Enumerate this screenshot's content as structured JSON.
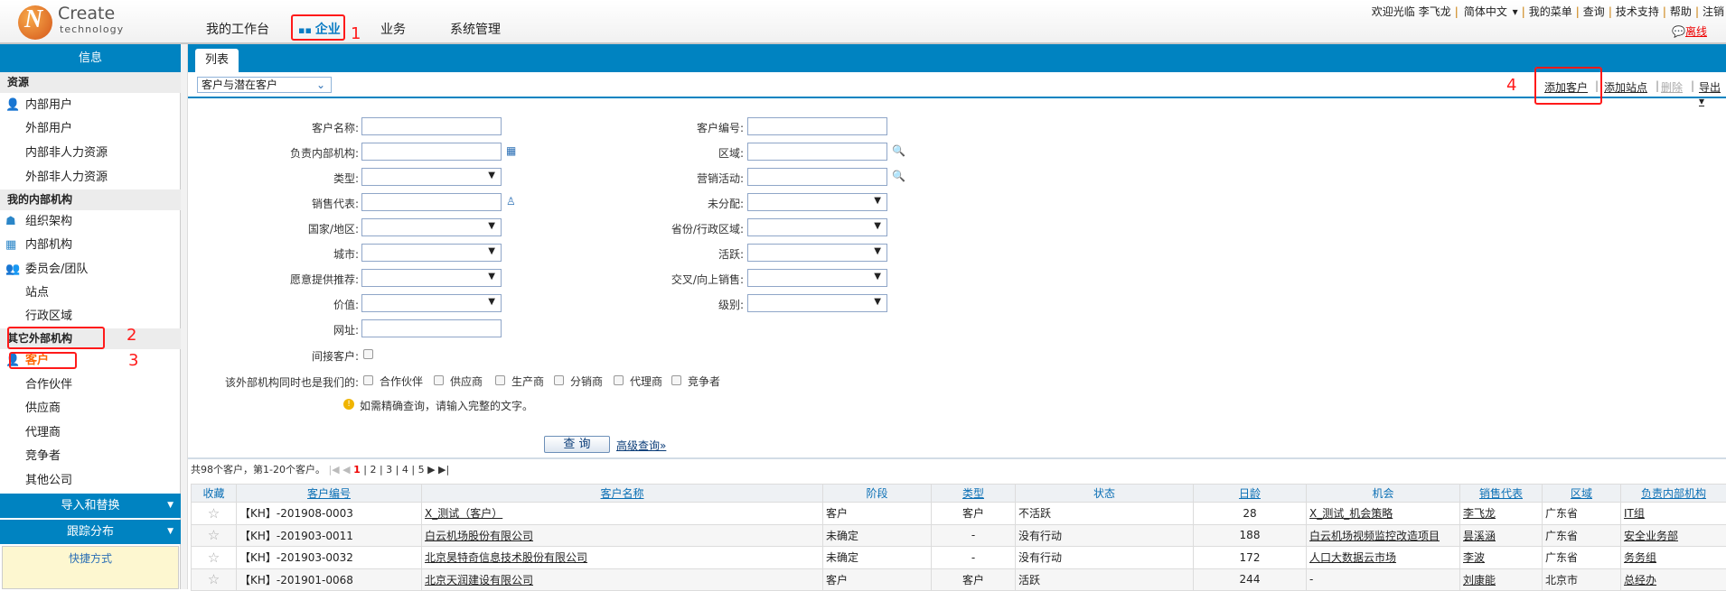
{
  "header": {
    "logo_text": "Create",
    "logo_sub": "technology",
    "nav": [
      "我的工作台",
      "企业",
      "业务",
      "系统管理"
    ],
    "active_nav": "企业",
    "top_links": [
      "欢迎光临",
      "李飞龙",
      "简体中文",
      "我的菜单",
      "查询",
      "技术支持",
      "帮助",
      "注销"
    ],
    "status": "离线"
  },
  "annotations": [
    "1",
    "2",
    "3",
    "4"
  ],
  "sidebar": {
    "title": "信息",
    "sections": [
      {
        "title": "资源",
        "items": [
          {
            "label": "内部用户",
            "icon": "user-icon"
          },
          {
            "label": "外部用户"
          },
          {
            "label": "内部非人力资源"
          },
          {
            "label": "外部非人力资源"
          }
        ]
      },
      {
        "title": "我的内部机构",
        "items": [
          {
            "label": "组织架构",
            "icon": "org-chart-icon"
          },
          {
            "label": "内部机构",
            "icon": "building-icon"
          },
          {
            "label": "委员会/团队",
            "icon": "team-icon"
          },
          {
            "label": "站点"
          },
          {
            "label": "行政区域"
          }
        ]
      },
      {
        "title": "其它外部机构",
        "items": [
          {
            "label": "客户",
            "icon": "user-icon",
            "active": true
          },
          {
            "label": "合作伙伴"
          },
          {
            "label": "供应商"
          },
          {
            "label": "代理商"
          },
          {
            "label": "竞争者"
          },
          {
            "label": "其他公司"
          }
        ]
      }
    ],
    "bars": [
      "导入和替换",
      "跟踪分布"
    ],
    "shortcut": "快捷方式"
  },
  "tab": "列表",
  "toolbar": {
    "filter": "客户与潜在客户",
    "links": [
      "添加客户",
      "添加站点",
      "删除",
      "导出"
    ]
  },
  "form": {
    "left": [
      {
        "label": "客户名称:",
        "type": "text"
      },
      {
        "label": "负责内部机构:",
        "type": "text",
        "icon": "building-icon"
      },
      {
        "label": "类型:",
        "type": "select"
      },
      {
        "label": "销售代表:",
        "type": "text",
        "icon": "person-icon"
      },
      {
        "label": "国家/地区:",
        "type": "select"
      },
      {
        "label": "城市:",
        "type": "select"
      },
      {
        "label": "愿意提供推荐:",
        "type": "select"
      },
      {
        "label": "价值:",
        "type": "select"
      },
      {
        "label": "网址:",
        "type": "text"
      }
    ],
    "right": [
      {
        "label": "客户编号:",
        "type": "text"
      },
      {
        "label": "区域:",
        "type": "text",
        "icon": "search-add-icon"
      },
      {
        "label": "营销活动:",
        "type": "text",
        "icon": "search-add-icon"
      },
      {
        "label": "未分配:",
        "type": "select"
      },
      {
        "label": "省份/行政区域:",
        "type": "select"
      },
      {
        "label": "活跃:",
        "type": "select"
      },
      {
        "label": "交叉/向上销售:",
        "type": "select"
      },
      {
        "label": "级别:",
        "type": "select"
      }
    ],
    "indirect_label": "间接客户:",
    "also_label": "该外部机构同时也是我们的:",
    "also_options": [
      "合作伙伴",
      "供应商",
      "生产商",
      "分销商",
      "代理商",
      "竞争者"
    ],
    "tip": "如需精确查询，请输入完整的文字。",
    "search": "查 询",
    "advanced": "高级查询»"
  },
  "pager": {
    "summary": "共98个客户，第1-20个客户。",
    "pages": [
      "1",
      "2",
      "3",
      "4",
      "5"
    ],
    "current": "1"
  },
  "table": {
    "columns": [
      "收藏",
      "客户编号",
      "客户名称",
      "阶段",
      "类型",
      "状态",
      "日龄",
      "机会",
      "销售代表",
      "区域",
      "负责内部机构"
    ],
    "rows": [
      [
        "☆",
        "【KH】-201908-0003",
        "X_测试（客户）",
        "客户",
        "客户",
        "不活跃",
        "28",
        "X_测试_机会策略",
        "李飞龙",
        "广东省",
        "IT组"
      ],
      [
        "☆",
        "【KH】-201903-0011",
        "白云机场股份有限公司",
        "未确定",
        "-",
        "没有行动",
        "188",
        "白云机场视频监控改造项目",
        "昙溪涵",
        "广东省",
        "安全业务部"
      ],
      [
        "☆",
        "【KH】-201903-0032",
        "北京昊特奇信息技术股份有限公司",
        "未确定",
        "-",
        "没有行动",
        "172",
        "人口大数据云市场",
        "李波",
        "广东省",
        "务务组"
      ],
      [
        "☆",
        "【KH】-201901-0068",
        "北京天润建设有限公司",
        "客户",
        "客户",
        "活跃",
        "244",
        "-",
        "刘康能",
        "北京市",
        "总经办"
      ]
    ]
  },
  "colors": {
    "accent": "#0083c1",
    "annotation": "#ff1a1a",
    "active_item": "#ff6600"
  }
}
